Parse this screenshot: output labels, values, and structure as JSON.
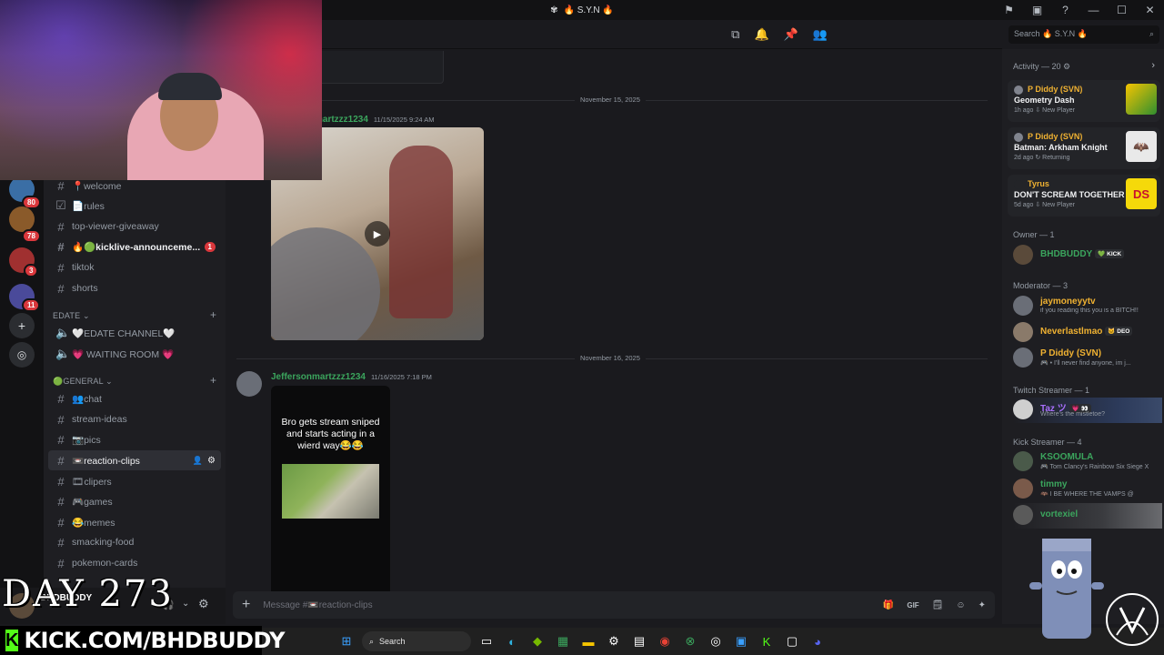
{
  "window": {
    "title": "🔥 S.Y.N 🔥"
  },
  "search": {
    "placeholder": "Search 🔥 S.Y.N 🔥"
  },
  "servers": {
    "badges": [
      "80",
      "78",
      "3",
      "11"
    ]
  },
  "channels": {
    "items": [
      {
        "label": "📍welcome",
        "icon": "hash"
      },
      {
        "label": "📄rules",
        "icon": "rules"
      },
      {
        "label": "top-viewer-giveaway",
        "icon": "hash"
      },
      {
        "label": "🔥🟢kicklive-announceme...",
        "icon": "hash",
        "badge": "1",
        "bold": true
      },
      {
        "label": "tiktok",
        "icon": "hash"
      },
      {
        "label": "shorts",
        "icon": "hash"
      }
    ],
    "cat_edate": "EDATE ⌄",
    "voice": [
      {
        "label": "🤍EDATE CHANNEL🤍"
      },
      {
        "label": "💗 WAITING ROOM 💗"
      }
    ],
    "cat_general": "🟢GENERAL ⌄",
    "general": [
      {
        "label": "👥chat"
      },
      {
        "label": "stream-ideas"
      },
      {
        "label": "📷pics"
      },
      {
        "label": "📼reaction-clips",
        "active": true
      },
      {
        "label": "🎞clipers"
      },
      {
        "label": "🎮games"
      },
      {
        "label": "😂memes"
      },
      {
        "label": "smacking-food"
      },
      {
        "label": "pokemon-cards"
      }
    ]
  },
  "user": {
    "name": "BHDBUDDY"
  },
  "messages": {
    "date1": "November 15, 2025",
    "date2": "November 16, 2025",
    "author1": "Jeffersonmartzzz1234",
    "author1_partial": "martzzz1234",
    "time1": "11/15/2025 9:24 AM",
    "author2": "Jeffersonmartzzz1234",
    "time2": "11/16/2025 7:18 PM",
    "clip_caption": "Bro gets stream sniped and starts acting in a wierd way😂😂"
  },
  "composer": {
    "placeholder": "Message #📼reaction-clips"
  },
  "members": {
    "activity_title": "Activity — 20 ⚙",
    "activities": [
      {
        "name": "P Diddy (SVN)",
        "game": "Geometry Dash",
        "sub": "1h ago  ⇩ New Player",
        "color": "#f0b232",
        "art": "#2f8f2f"
      },
      {
        "name": "P Diddy (SVN)",
        "game": "Batman: Arkham Knight",
        "sub": "2d ago  ↻ Returning",
        "color": "#f0b232",
        "art": "#e9e9e9"
      },
      {
        "name": "Tyrus",
        "game": "DON'T SCREAM TOGETHER",
        "sub": "5d ago  ⇩ New Player",
        "color": "#f0b232",
        "art": "#f5d90a"
      }
    ],
    "roles": {
      "owner": "Owner — 1",
      "moderator": "Moderator — 3",
      "twitch": "Twitch Streamer — 1",
      "kick": "Kick Streamer — 4"
    },
    "owner": [
      {
        "name": "BHDBUDDY",
        "tag": "💚 KICK",
        "color": "#3ba55d"
      }
    ],
    "moderators": [
      {
        "name": "jaymoneyytv",
        "status": "if you reading this you is a BITCH!!",
        "color": "#f0b232"
      },
      {
        "name": "Neverlastlmao",
        "tag": "🐱 DEO",
        "color": "#f0b232"
      },
      {
        "name": "P Diddy (SVN)",
        "status": "🎮 • I'll never find anyone, im j...",
        "color": "#f0b232"
      }
    ],
    "twitch": [
      {
        "name": "Taz ツ",
        "tag": "💗 👀",
        "status": "Where's the mistletoe?",
        "color": "#a970ff"
      }
    ],
    "kick_streamers": [
      {
        "name": "KSOOMULA",
        "status": "🎮 Tom Clancy's Rainbow Six Siege X",
        "color": "#3ba55d"
      },
      {
        "name": "timmy",
        "status": "🦇 I BE WHERE THE VAMPS @",
        "color": "#3ba55d"
      },
      {
        "name": "vortexiel",
        "status": "",
        "color": "#3ba55d"
      }
    ]
  },
  "taskbar": {
    "search": "Search"
  },
  "overlay": {
    "day": "DAY 273",
    "kick_url": "KICK.COM/BHDBUDDY"
  }
}
